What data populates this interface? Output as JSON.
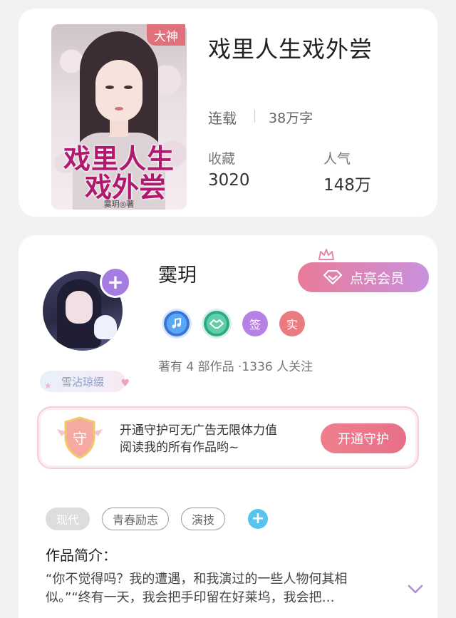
{
  "book": {
    "title": "戏里人生戏外尝",
    "cover_title_line1": "戏里人生",
    "cover_title_line2": "戏外尝",
    "cover_author_mark": "霙玥◎著",
    "badge": "大神",
    "status": "连载",
    "word_count": "38万字",
    "stats": [
      {
        "label": "收藏",
        "value": "3020"
      },
      {
        "label": "人气",
        "value": "148万"
      }
    ]
  },
  "author": {
    "name": "霙玥",
    "follow_plus": "+",
    "fan_badge": "雪沾琼缀",
    "vip_button": "点亮会员",
    "medals": [
      "",
      "",
      "签",
      "实"
    ],
    "follow_info": "著有 4 部作品 ·1336 人关注"
  },
  "guard": {
    "icon_char": "守",
    "text_line1": "开通守护可无广告无限体力值",
    "text_line2": "阅读我的所有作品哟~",
    "button": "开通守护"
  },
  "tags": [
    "现代",
    "青春励志",
    "演技"
  ],
  "tag_add": "+",
  "intro": {
    "heading": "作品简介：",
    "line1": "“你不觉得吗？我的遭遇，和我演过的一些人物何其相",
    "line2": "似。”“终有一天，我会把手印留在好莱坞，我会把…"
  },
  "colors": {
    "badge": "#e07079",
    "vip_gradient_start": "#e97b97",
    "vip_gradient_end": "#c991de",
    "guard_button": "#ee7f8c",
    "tag_add": "#57c3ef"
  }
}
